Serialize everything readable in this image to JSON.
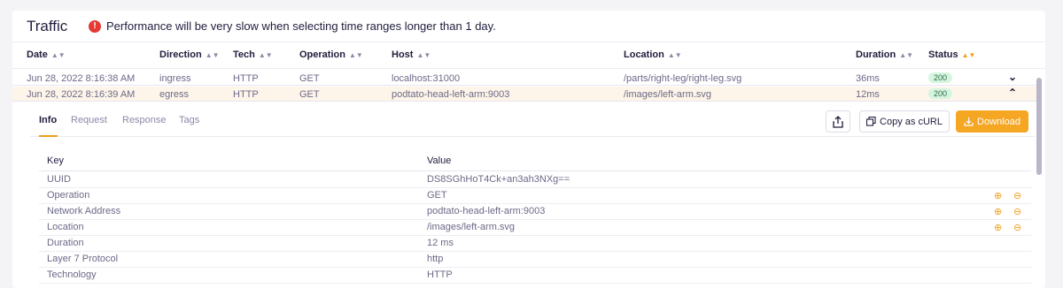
{
  "header": {
    "title": "Traffic",
    "warning": "Performance will be very slow when selecting time ranges longer than 1 day."
  },
  "table": {
    "columns": [
      "Date",
      "Direction",
      "Tech",
      "Operation",
      "Host",
      "Location",
      "Duration",
      "Status"
    ],
    "rows": [
      {
        "date": "Jun 28, 2022 8:16:38 AM",
        "direction": "ingress",
        "tech": "HTTP",
        "operation": "GET",
        "host": "localhost:31000",
        "location": "/parts/right-leg/right-leg.svg",
        "duration": "36ms",
        "status": "200"
      },
      {
        "date": "Jun 28, 2022 8:16:39 AM",
        "direction": "egress",
        "tech": "HTTP",
        "operation": "GET",
        "host": "podtato-head-left-arm:9003",
        "location": "/images/left-arm.svg",
        "duration": "12ms",
        "status": "200"
      }
    ]
  },
  "details": {
    "tabs": [
      "Info",
      "Request",
      "Response",
      "Tags"
    ],
    "copy_curl": "Copy as cURL",
    "download": "Download",
    "kv_headers": {
      "key": "Key",
      "value": "Value"
    },
    "kv": [
      {
        "key": "UUID",
        "value": "DS8SGhHoT4Ck+an3ah3NXg=="
      },
      {
        "key": "Operation",
        "value": "GET"
      },
      {
        "key": "Network Address",
        "value": "podtato-head-left-arm:9003"
      },
      {
        "key": "Location",
        "value": "/images/left-arm.svg"
      },
      {
        "key": "Duration",
        "value": "12 ms"
      },
      {
        "key": "Layer 7 Protocol",
        "value": "http"
      },
      {
        "key": "Technology",
        "value": "HTTP"
      }
    ]
  },
  "colors": {
    "accent": "#f5a623",
    "status_ok_bg": "#d6f5e0",
    "warning": "#e53935"
  }
}
